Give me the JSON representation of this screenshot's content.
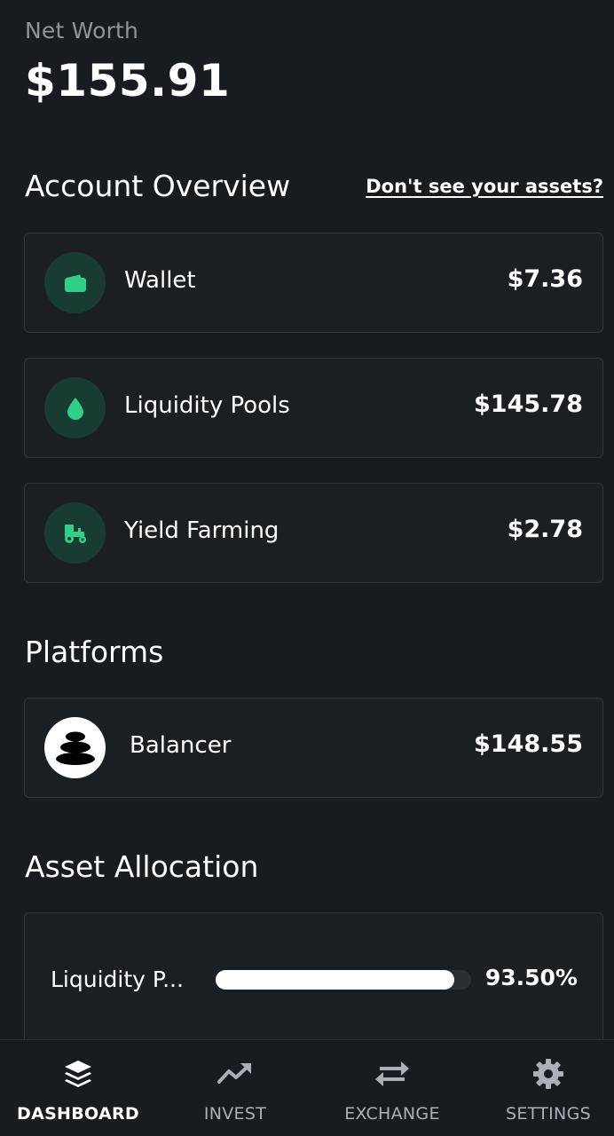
{
  "header": {
    "net_worth_label": "Net Worth",
    "net_worth_value": "$155.91"
  },
  "account_overview": {
    "title": "Account Overview",
    "help_link": "Don't see your assets?",
    "items": [
      {
        "label": "Wallet",
        "value": "$7.36",
        "icon": "wallet-icon"
      },
      {
        "label": "Liquidity Pools",
        "value": "$145.78",
        "icon": "drop-icon"
      },
      {
        "label": "Yield Farming",
        "value": "$2.78",
        "icon": "tractor-icon"
      }
    ]
  },
  "platforms": {
    "title": "Platforms",
    "items": [
      {
        "label": "Balancer",
        "value": "$148.55",
        "icon": "balancer-logo"
      }
    ]
  },
  "asset_allocation": {
    "title": "Asset Allocation",
    "items": [
      {
        "label": "Liquidity P...",
        "percent_text": "93.50%",
        "fraction": 0.935
      }
    ]
  },
  "bottom_nav": {
    "items": [
      {
        "label": "DASHBOARD",
        "icon": "layers-icon",
        "active": true
      },
      {
        "label": "INVEST",
        "icon": "trend-up-icon",
        "active": false
      },
      {
        "label": "EXCHANGE",
        "icon": "swap-arrows-icon",
        "active": false
      },
      {
        "label": "SETTINGS",
        "icon": "gear-icon",
        "active": false
      }
    ]
  },
  "colors": {
    "background": "#181c20",
    "card": "#1b1f23",
    "accent_green": "#2fd089",
    "icon_circle": "#183b32",
    "muted_text": "#8e959c"
  }
}
